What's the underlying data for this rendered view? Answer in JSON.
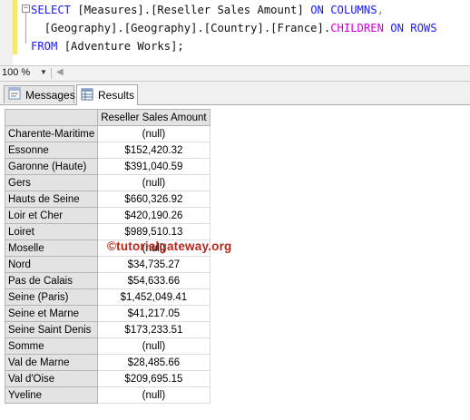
{
  "query": {
    "line1": {
      "kw_select": "SELECT",
      "measure": " [Measures].[Reseller Sales Amount] ",
      "kw_on_columns": "ON COLUMNS",
      "comma": ","
    },
    "line2": {
      "path": "[Geography].[Geography].[Country].[France].",
      "fn_children": "CHILDREN",
      "kw_on_rows": " ON ROWS"
    },
    "line3": {
      "kw_from": "FROM",
      "cube": " [Adventure Works];"
    },
    "collapse_glyph": "−"
  },
  "zoom": {
    "value": "100 %"
  },
  "tabs": [
    {
      "label": "Messages",
      "icon": "messages-icon",
      "active": false
    },
    {
      "label": "Results",
      "icon": "grid-icon",
      "active": true
    }
  ],
  "results": {
    "column_header": "Reseller Sales Amount",
    "rows": [
      {
        "name": "Charente-Maritime",
        "value": "(null)"
      },
      {
        "name": "Essonne",
        "value": "$152,420.32"
      },
      {
        "name": "Garonne (Haute)",
        "value": "$391,040.59"
      },
      {
        "name": "Gers",
        "value": "(null)"
      },
      {
        "name": "Hauts de Seine",
        "value": "$660,326.92"
      },
      {
        "name": "Loir et Cher",
        "value": "$420,190.26"
      },
      {
        "name": "Loiret",
        "value": "$989,510.13"
      },
      {
        "name": "Moselle",
        "value": "(null)"
      },
      {
        "name": "Nord",
        "value": "$34,735.27"
      },
      {
        "name": "Pas de Calais",
        "value": "$54,633.66"
      },
      {
        "name": "Seine (Paris)",
        "value": "$1,452,049.41"
      },
      {
        "name": "Seine et Marne",
        "value": "$41,217.05"
      },
      {
        "name": "Seine Saint Denis",
        "value": "$173,233.51"
      },
      {
        "name": "Somme",
        "value": "(null)"
      },
      {
        "name": "Val de Marne",
        "value": "$28,485.66"
      },
      {
        "name": "Val d'Oise",
        "value": "$209,695.15"
      },
      {
        "name": "Yveline",
        "value": "(null)"
      }
    ]
  },
  "watermark": "©tutorialgateway.org",
  "colors": {
    "keyword": "#1a1aff",
    "function": "#d000d0",
    "watermark": "#b8281a",
    "change_bar": "#f4e96c"
  }
}
